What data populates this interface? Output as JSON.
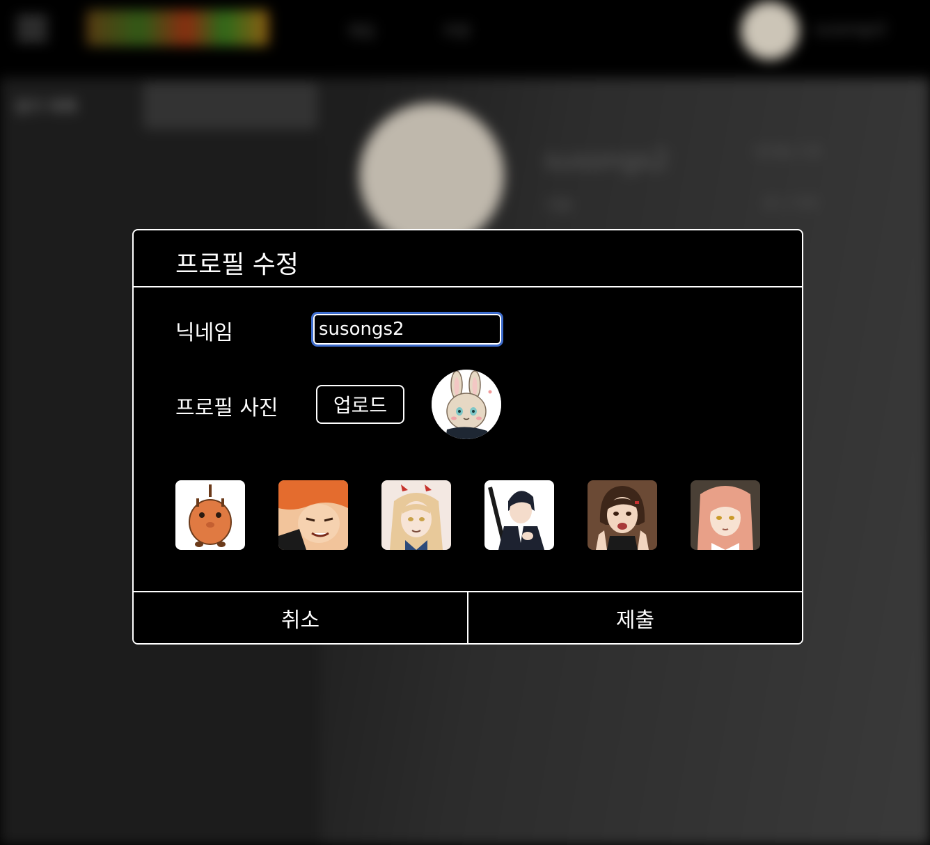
{
  "background": {
    "nav_items": [
      "게임",
      "커뮤"
    ],
    "username": "susongs2",
    "sidebar_label": "참가 목록",
    "sidebar_button": "방 만들기 이어하기",
    "profile_name": "susongs2",
    "profile_sub": "기본",
    "edit_button": "프로필 수정",
    "logout_button": "로그 아웃"
  },
  "modal": {
    "title": "프로필 수정",
    "nickname_label": "닉네임",
    "nickname_value": "susongs2",
    "photo_label": "프로필 사진",
    "upload_label": "업로드",
    "cancel_label": "취소",
    "submit_label": "제출"
  },
  "avatar_choices": [
    {
      "icon": "pochita-avatar-icon",
      "bg": "#ffffff",
      "main": "#e07a42"
    },
    {
      "icon": "orange-hair-boy-avatar-icon",
      "bg": "#f2c49b",
      "main": "#e46c2e"
    },
    {
      "icon": "blonde-girl-avatar-icon",
      "bg": "#f3e8e2",
      "main": "#e8c99a"
    },
    {
      "icon": "black-hair-swordsman-avatar-icon",
      "bg": "#ffffff",
      "main": "#1d2230"
    },
    {
      "icon": "brown-hair-girl-avatar-icon",
      "bg": "#6b4a35",
      "main": "#3d2619"
    },
    {
      "icon": "pink-hair-woman-avatar-icon",
      "bg": "#4a4036",
      "main": "#e8a088"
    }
  ]
}
